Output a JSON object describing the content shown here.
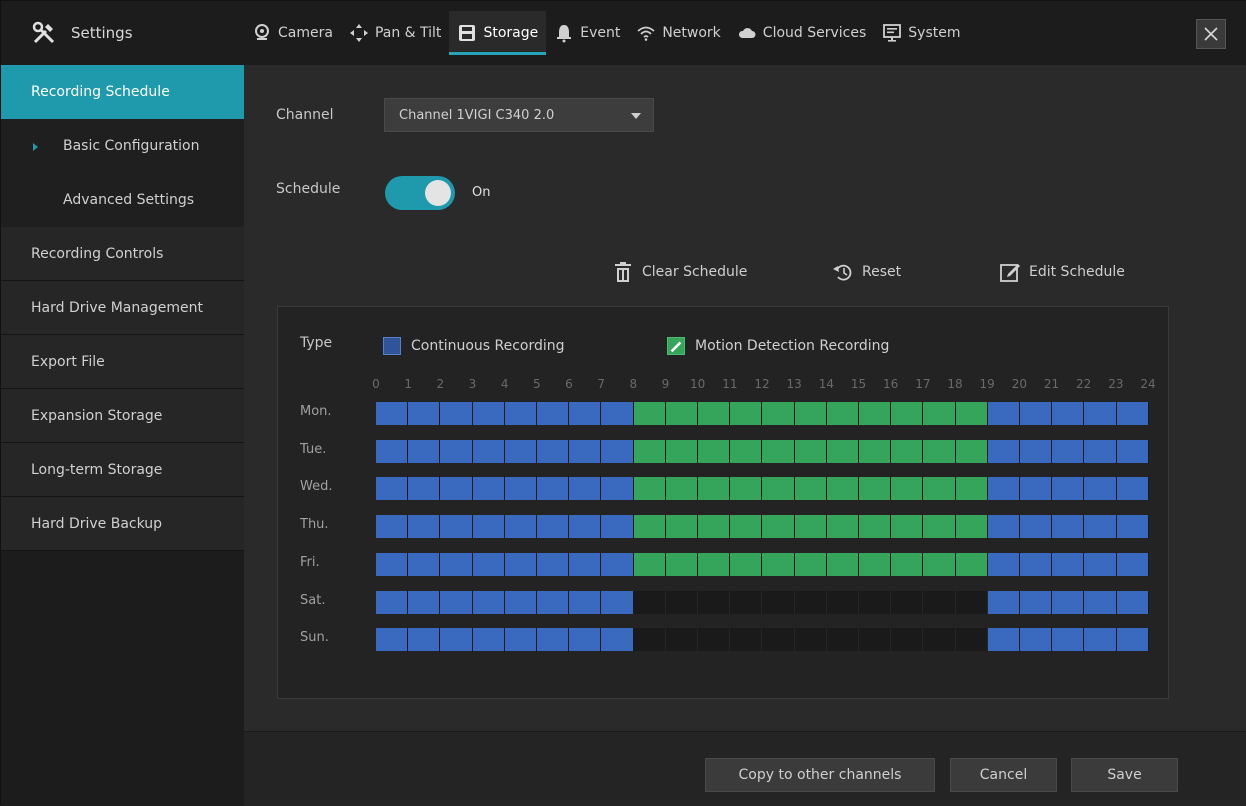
{
  "brand": {
    "title": "Settings"
  },
  "tabs": [
    {
      "label": "Camera",
      "icon": "camera-icon"
    },
    {
      "label": "Pan & Tilt",
      "icon": "pan-tilt-icon"
    },
    {
      "label": "Storage",
      "icon": "storage-icon",
      "active": true
    },
    {
      "label": "Event",
      "icon": "bell-icon"
    },
    {
      "label": "Network",
      "icon": "wifi-icon"
    },
    {
      "label": "Cloud Services",
      "icon": "cloud-icon"
    },
    {
      "label": "System",
      "icon": "monitor-icon"
    }
  ],
  "sidebar": {
    "items": [
      {
        "label": "Recording Schedule"
      },
      {
        "label": "Basic Configuration"
      },
      {
        "label": "Advanced Settings"
      },
      {
        "label": "Recording Controls"
      },
      {
        "label": "Hard Drive Management"
      },
      {
        "label": "Export File"
      },
      {
        "label": "Expansion Storage"
      },
      {
        "label": "Long-term Storage"
      },
      {
        "label": "Hard Drive Backup"
      }
    ]
  },
  "main": {
    "channel_label": "Channel",
    "channel_value": "Channel 1VIGI C340 2.0",
    "schedule_label": "Schedule",
    "schedule_state": "On",
    "tools": {
      "clear": "Clear Schedule",
      "reset": "Reset",
      "edit": "Edit Schedule"
    },
    "panel": {
      "type_label": "Type",
      "legend_continuous": "Continuous Recording",
      "legend_motion": "Motion Detection Recording",
      "hours": [
        "0",
        "1",
        "2",
        "3",
        "4",
        "5",
        "6",
        "7",
        "8",
        "9",
        "10",
        "11",
        "12",
        "13",
        "14",
        "15",
        "16",
        "17",
        "18",
        "19",
        "20",
        "21",
        "22",
        "23",
        "24"
      ],
      "days": [
        "Mon.",
        "Tue.",
        "Wed.",
        "Thu.",
        "Fri.",
        "Sat.",
        "Sun."
      ],
      "schedule": {
        "Mon.": "CCCCCCCCMMMMMMMMMMMCCCCC",
        "Tue.": "CCCCCCCCMMMMMMMMMMMCCCCC",
        "Wed.": "CCCCCCCCMMMMMMMMMMMCCCCC",
        "Thu.": "CCCCCCCCMMMMMMMMMMMCCCCC",
        "Fri.": "CCCCCCCCMMMMMMMMMMMCCCCC",
        "Sat.": "CCCCCCCCNNNNNNNNNNNCCCCC",
        "Sun.": "CCCCCCCCNNNNNNNNNNNCCCCC"
      },
      "colors": {
        "continuous": "#3a6ac0",
        "motion": "#34a55a",
        "none": "#1a1a1a"
      }
    }
  },
  "footer": {
    "copy": "Copy to other channels",
    "cancel": "Cancel",
    "save": "Save"
  },
  "accent": "#1e9aac"
}
